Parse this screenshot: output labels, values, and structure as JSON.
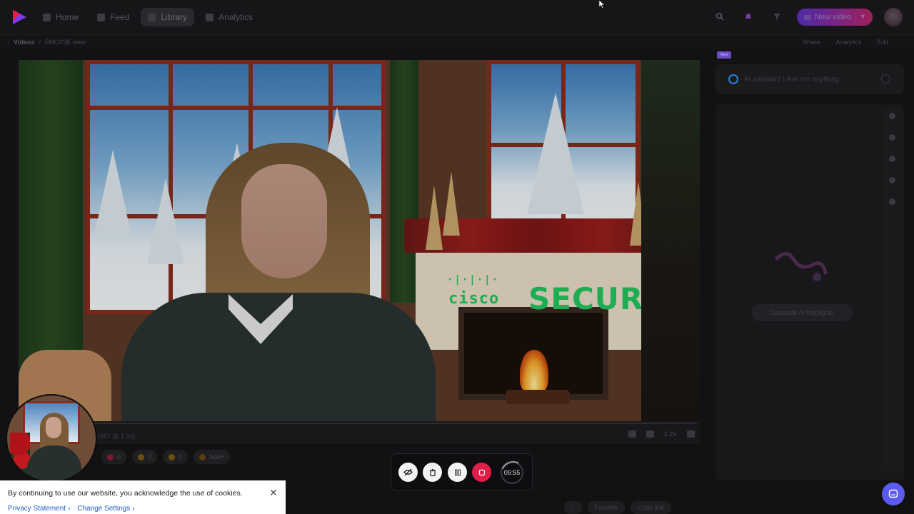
{
  "nav": {
    "items": [
      {
        "label": "Home",
        "icon": "home-icon"
      },
      {
        "label": "Feed",
        "icon": "feed-icon"
      },
      {
        "label": "Library",
        "icon": "library-icon",
        "active": true
      },
      {
        "label": "Analytics",
        "icon": "analytics-icon"
      }
    ],
    "new_video_label": "New video"
  },
  "breadcrumb": {
    "root": "Videos",
    "current": "FMC/ISE view"
  },
  "page_actions": [
    "Share",
    "Analytics",
    "Edit"
  ],
  "video": {
    "overlay_brand_small": "cisco",
    "overlay_brand_dots": "·|·|·|·",
    "overlay_brand_big": "SECURE",
    "time": "2:00/7 @ 1.2x)",
    "speed": "1.2x"
  },
  "ai_panel": {
    "tag": "New",
    "placeholder": "AI assistant | Ask me anything",
    "action_label": "Generate AI highlights"
  },
  "reactions": [
    {
      "icon": "heart-icon",
      "count": "0",
      "color": "#be123c"
    },
    {
      "icon": "clap-icon",
      "count": "0",
      "color": "#ca8a04"
    },
    {
      "icon": "smile-icon",
      "count": "0",
      "color": "#ca8a04"
    },
    {
      "label": "Add+",
      "icon": "emoji-icon",
      "color": "#a16207"
    }
  ],
  "recorder": {
    "timer": "05:55"
  },
  "cookie_banner": {
    "message": "By continuing to use our website, you acknowledge the use of cookies.",
    "privacy_link": "Privacy Statement",
    "settings_link": "Change Settings",
    "link_chevron": "›"
  },
  "bottom_actions": [
    "Favorite",
    "Copy link"
  ],
  "colors": {
    "accent": "#5b5bf0",
    "record": "#e11d48",
    "brand_overlay": "#22c55e"
  }
}
